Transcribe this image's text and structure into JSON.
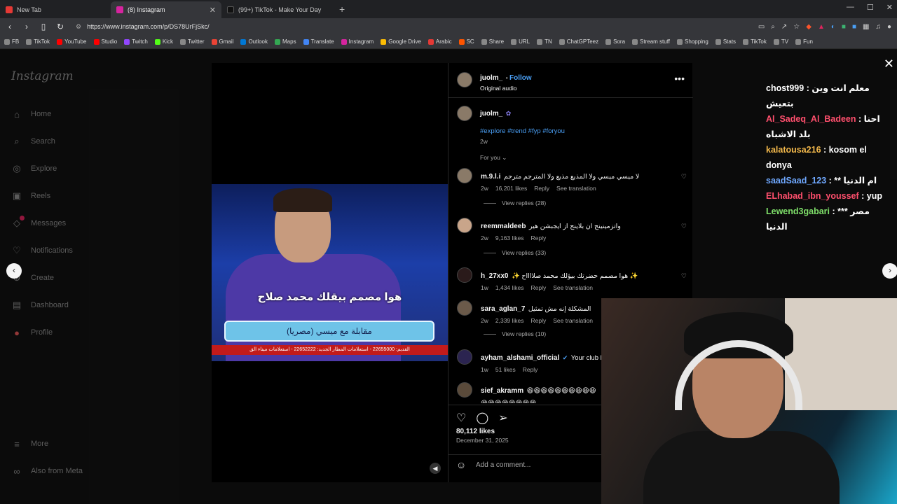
{
  "browser": {
    "tabs": [
      {
        "title": "New Tab",
        "color": "#e53935"
      },
      {
        "title": "(8) Instagram",
        "color": "#d6249f"
      },
      {
        "title": "(99+) TikTok - Make Your Day",
        "color": "#111111"
      }
    ],
    "url": "https://www.instagram.com/p/DS78UrFjSkc/",
    "bookmarks": [
      "FB",
      "TikTok",
      "YouTube",
      "Studio",
      "Twitch",
      "Kick",
      "Twitter",
      "Gmail",
      "Outlook",
      "Maps",
      "Translate",
      "Instagram",
      "Google Drive",
      "Arabic",
      "SC",
      "Share",
      "URL",
      "TN",
      "ChatGPTeez",
      "Sora",
      "Stream stuff",
      "Shopping",
      "Stats",
      "TikTok",
      "TV",
      "Fun"
    ]
  },
  "sidebar": {
    "logo": "Instagram",
    "items": [
      "Home",
      "Search",
      "Explore",
      "Reels",
      "Messages",
      "Notifications",
      "Create",
      "Dashboard",
      "Profile"
    ],
    "bottom": [
      "More",
      "Also from Meta"
    ]
  },
  "video": {
    "subtitle": "هوا مصمم بيقلك محمد صلاح",
    "banner": "مقابلة مع ميسي (مصريا)",
    "ticker": "القديم: 22655000 - استعلامات المطار الجديد: 22652222 - استعلامات ميناء الق"
  },
  "post": {
    "author": "juolm_",
    "follow": "Follow",
    "audio": "Original audio",
    "caption_user": "juolm_",
    "hashtags": "#explore #trend #fyp #foryou",
    "caption_time": "2w",
    "for_you": "For you",
    "likes": "80,112 likes",
    "date": "December 31, 2025",
    "add_comment": "Add a comment...",
    "comments": [
      {
        "user": "m.9.l.i",
        "text": "لا ميسي ميسي ولا المذيع مذيع ولا المترجم مترجم",
        "time": "2w",
        "likes": "16,201 likes",
        "reply": "Reply",
        "translate": "See translation",
        "replies": "View replies (28)"
      },
      {
        "user": "reemmaldeeb",
        "text": "واتزمينينج ان بلاينج از ايجبشن هير",
        "time": "2w",
        "likes": "9,163 likes",
        "reply": "Reply",
        "translate": "",
        "replies": "View replies (33)"
      },
      {
        "user": "h_27xx0",
        "text": "✨ هوا مصمم حضرتك بيؤلك محمد صلااااح ✨",
        "time": "1w",
        "likes": "1,434 likes",
        "reply": "Reply",
        "translate": "See translation",
        "replies": ""
      },
      {
        "user": "sara_aglan_7",
        "text": "المشكلة إنه مش تمثيل",
        "time": "2w",
        "likes": "2,339 likes",
        "reply": "Reply",
        "translate": "See translation",
        "replies": "View replies (10)"
      },
      {
        "user": "ayham_alshami_official",
        "text": "Your club her",
        "time": "1w",
        "likes": "51 likes",
        "reply": "Reply",
        "translate": "",
        "replies": ""
      },
      {
        "user": "sief_akramm",
        "text": "😆😆😆😆😆😆😆😆😆😆😆😆😆😆😆😆😆😆",
        "time": "",
        "likes": "",
        "reply": "",
        "translate": "",
        "replies": ""
      }
    ]
  },
  "chat": [
    {
      "user": "chost999",
      "color": "#ffffff",
      "text": ": معلم انت وين بتعيش"
    },
    {
      "user": "Al_Sadeq_Al_Badeen",
      "color": "#ff4f6d",
      "text": ": احنا بلد الاشباه"
    },
    {
      "user": "kalatousa216",
      "color": "#f2b84b",
      "text": ": kosom el donya"
    },
    {
      "user": "saadSaad_123",
      "color": "#6fa8ff",
      "text": ": ** ام الدنيا"
    },
    {
      "user": "ELhabad_ibn_youssef",
      "color": "#ff4f6d",
      "text": ": yup"
    },
    {
      "user": "Lewend3gabari",
      "color": "#7fe06a",
      "text": ": *** مصر الدنيا"
    }
  ]
}
